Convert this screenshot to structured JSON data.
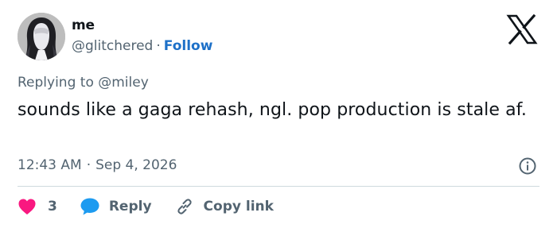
{
  "author": {
    "name": "me",
    "handle": "@glitchered",
    "separator": "·",
    "follow_label": "Follow"
  },
  "reply_context": {
    "prefix": "Replying to",
    "mention": "@miley"
  },
  "tweet": {
    "text": "sounds like a gaga rehash, ngl. pop production is stale af.",
    "time": "12:43 AM",
    "separator": "·",
    "date": "Sep 4, 2026"
  },
  "actions": {
    "like_count": "3",
    "reply_label": "Reply",
    "copy_link_label": "Copy link"
  },
  "icons": {
    "logo": "x-logo-icon",
    "info": "info-icon",
    "like": "heart-icon",
    "reply": "speech-bubble-icon",
    "copy": "link-icon"
  },
  "colors": {
    "follow": "#1d70c8",
    "heart": "#f91880",
    "reply_bubble": "#1d9bf0",
    "muted_text": "#536471",
    "divider": "#cfd9de"
  }
}
